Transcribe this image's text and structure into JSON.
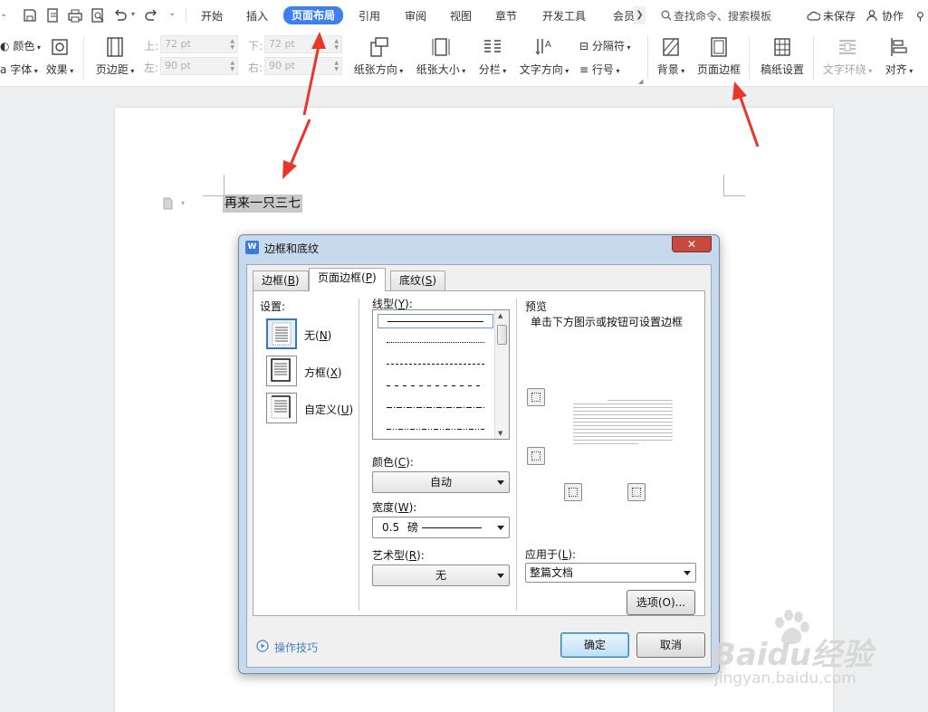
{
  "tabbar": {
    "tabs": [
      "开始",
      "插入",
      "页面布局",
      "引用",
      "审阅",
      "视图",
      "章节",
      "开发工具",
      "会员"
    ],
    "active_tab": "页面布局",
    "search_placeholder": "查找命令、搜索模板",
    "unsaved": "未保存",
    "collab": "协作"
  },
  "ribbon": {
    "color_label": "颜色",
    "font_label": "字体",
    "effect_label": "效果",
    "margins_label": "页边距",
    "top_label": "上:",
    "top_value": "72 pt",
    "bottom_label": "下:",
    "bottom_value": "72 pt",
    "left_label": "左:",
    "left_value": "90 pt",
    "right_label": "右:",
    "right_value": "90 pt",
    "orientation_label": "纸张方向",
    "size_label": "纸张大小",
    "columns_label": "分栏",
    "text_direction_label": "文字方向",
    "breaks_label": "分隔符",
    "line_numbers_label": "行号",
    "background_label": "背景",
    "page_border_label": "页面边框",
    "draft_paper_label": "稿纸设置",
    "text_wrap_label": "文字环绕",
    "align_label": "对齐"
  },
  "document": {
    "text": "再来一只三七"
  },
  "dialog": {
    "title": "边框和底纹",
    "close": "✕",
    "tabs": [
      {
        "label": "边框(",
        "key": "B",
        "end": ")"
      },
      {
        "label": "页面边框(",
        "key": "P",
        "end": ")"
      },
      {
        "label": "底纹(",
        "key": "S",
        "end": ")"
      }
    ],
    "active_tab": "页面边框(P)",
    "settings_label": "设置:",
    "settings": [
      {
        "label": "无(",
        "key": "N",
        "end": ")"
      },
      {
        "label": "方框(",
        "key": "X",
        "end": ")"
      },
      {
        "label": "自定义(",
        "key": "U",
        "end": ")"
      }
    ],
    "line_style_label": "线型(",
    "line_style_key": "Y",
    "line_style_end": "):",
    "color_label": "颜色(",
    "color_key": "C",
    "color_end": "):",
    "color_value": "自动",
    "width_label": "宽度(",
    "width_key": "W",
    "width_end": "):",
    "width_value": "0.5",
    "width_unit": "磅",
    "art_label": "艺术型(",
    "art_key": "R",
    "art_end": "):",
    "art_value": "无",
    "preview_label": "预览",
    "preview_hint": "单击下方图示或按钮可设置边框",
    "apply_label": "应用于(",
    "apply_key": "L",
    "apply_end": "):",
    "apply_value": "整篇文档",
    "options_button": "选项(O)...",
    "tips_link": "操作技巧",
    "ok_button": "确定",
    "cancel_button": "取消"
  },
  "watermark": {
    "brand": "Baidu经验",
    "url": "jingyan.baidu.com"
  },
  "colors": {
    "accent": "#3d7ff0",
    "annotation_arrow": "#e8372a",
    "dialog_frame": "#c7d9ed"
  }
}
